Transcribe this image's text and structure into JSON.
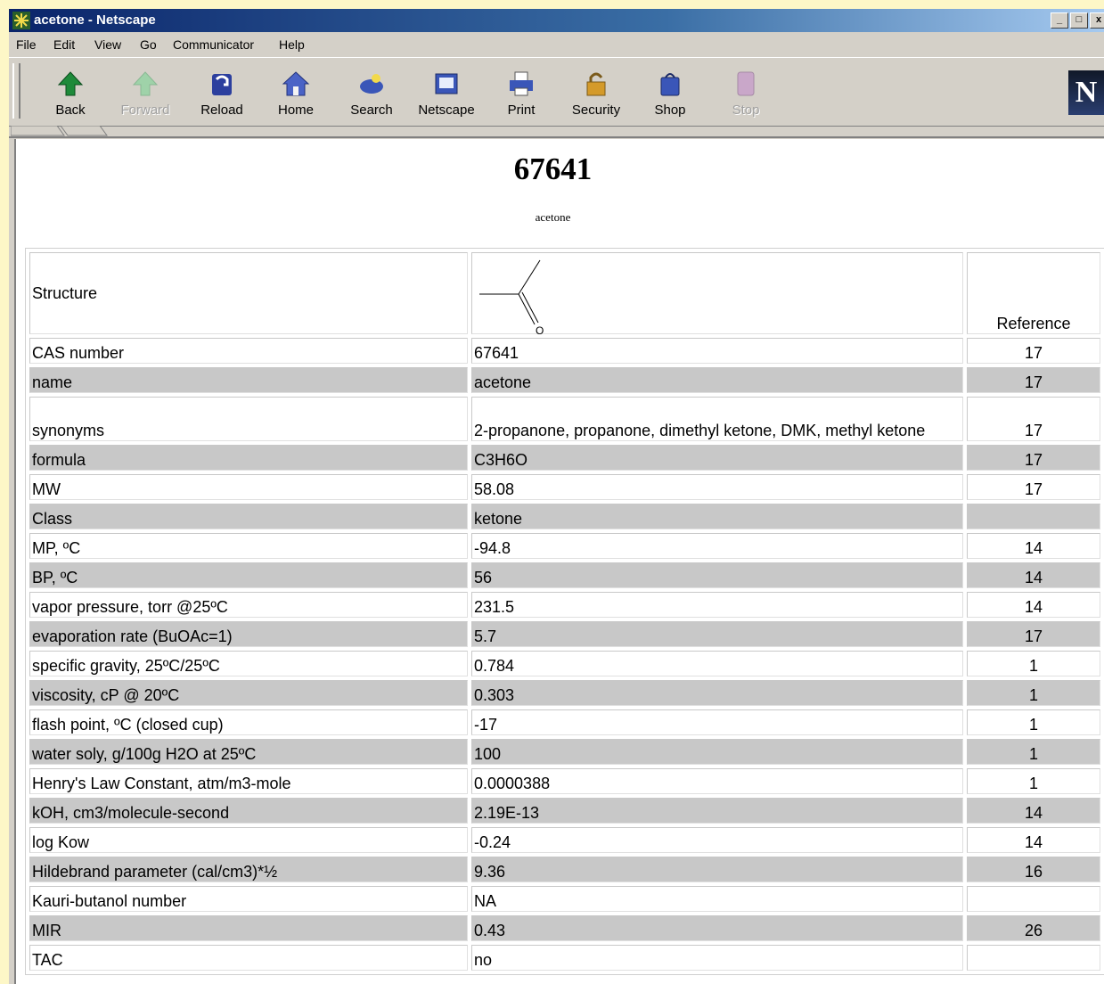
{
  "window": {
    "title": "acetone - Netscape",
    "controls": [
      "_",
      "□",
      "x"
    ]
  },
  "menubar": {
    "items": [
      "File",
      "Edit",
      "View",
      "Go",
      "Communicator",
      "Help"
    ]
  },
  "toolbar": {
    "buttons": [
      {
        "label": "Back",
        "icon": "back-arrow-icon",
        "enabled": true
      },
      {
        "label": "Forward",
        "icon": "forward-arrow-icon",
        "enabled": false
      },
      {
        "label": "Reload",
        "icon": "reload-icon",
        "enabled": true
      },
      {
        "label": "Home",
        "icon": "home-icon",
        "enabled": true
      },
      {
        "label": "Search",
        "icon": "search-icon",
        "enabled": true
      },
      {
        "label": "Netscape",
        "icon": "netscape-icon",
        "enabled": true
      },
      {
        "label": "Print",
        "icon": "print-icon",
        "enabled": true
      },
      {
        "label": "Security",
        "icon": "lock-icon",
        "enabled": true
      },
      {
        "label": "Shop",
        "icon": "shop-icon",
        "enabled": true
      },
      {
        "label": "Stop",
        "icon": "stop-icon",
        "enabled": false
      }
    ],
    "logo": "N"
  },
  "page": {
    "heading": "67641",
    "subtitle": "acetone",
    "structure_label": "Structure",
    "structure_atom": "O",
    "reference_header": "Reference",
    "rows": [
      {
        "property": "CAS number",
        "value": "67641",
        "reference": "17"
      },
      {
        "property": "name",
        "value": "acetone",
        "reference": "17"
      },
      {
        "property": "synonyms",
        "value": "2-propanone, propanone, dimethyl ketone, DMK, methyl ketone",
        "reference": "17"
      },
      {
        "property": "formula",
        "value": "C3H6O",
        "reference": "17"
      },
      {
        "property": "MW",
        "value": "58.08",
        "reference": "17"
      },
      {
        "property": "Class",
        "value": "ketone",
        "reference": ""
      },
      {
        "property": "MP, ºC",
        "value": "-94.8",
        "reference": "14"
      },
      {
        "property": "BP, ºC",
        "value": "56",
        "reference": "14"
      },
      {
        "property": "vapor pressure, torr @25ºC",
        "value": "231.5",
        "reference": "14"
      },
      {
        "property": "evaporation rate (BuOAc=1)",
        "value": "5.7",
        "reference": "17"
      },
      {
        "property": "specific gravity, 25ºC/25ºC",
        "value": "0.784",
        "reference": "1"
      },
      {
        "property": "viscosity, cP @ 20ºC",
        "value": "0.303",
        "reference": "1"
      },
      {
        "property": "flash point, ºC (closed cup)",
        "value": "-17",
        "reference": "1"
      },
      {
        "property": "water soly, g/100g H2O at 25ºC",
        "value": "100",
        "reference": "1"
      },
      {
        "property": "Henry's Law Constant, atm/m3-mole",
        "value": "0.0000388",
        "reference": "1"
      },
      {
        "property": "kOH, cm3/molecule-second",
        "value": "2.19E-13",
        "reference": "14"
      },
      {
        "property": "log Kow",
        "value": "-0.24",
        "reference": "14"
      },
      {
        "property": "Hildebrand parameter (cal/cm3)*½",
        "value": "9.36",
        "reference": "16"
      },
      {
        "property": "Kauri-butanol number",
        "value": "NA",
        "reference": ""
      },
      {
        "property": "MIR",
        "value": "0.43",
        "reference": "26"
      },
      {
        "property": "TAC",
        "value": "no",
        "reference": ""
      }
    ]
  }
}
